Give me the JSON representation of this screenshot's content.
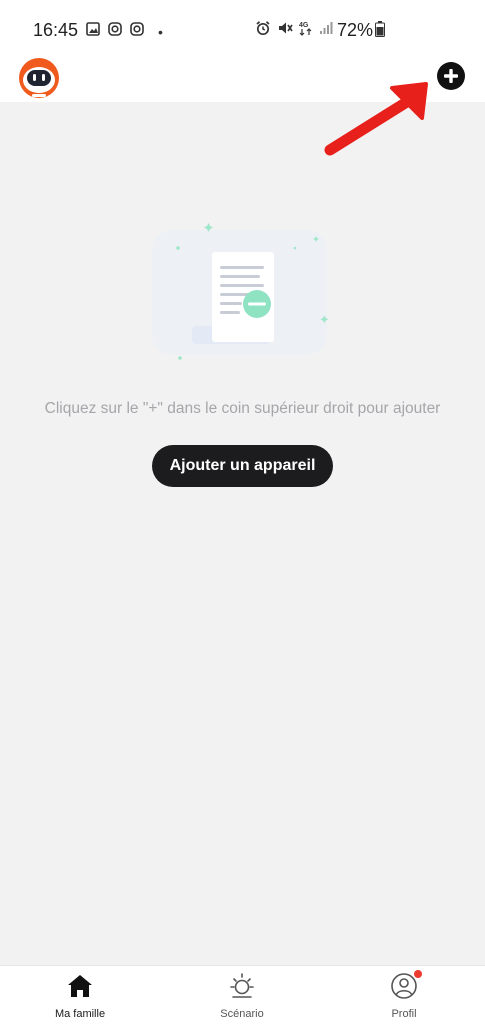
{
  "status_bar": {
    "time": "16:45",
    "battery": "72%",
    "dot": "•",
    "icons_left": [
      "gallery-icon",
      "instagram-icon",
      "instagram-icon"
    ],
    "icons_right": [
      "alarm-icon",
      "mute-icon",
      "4g-icon",
      "signal-icon",
      "battery-icon"
    ]
  },
  "header": {
    "avatar_icon": "robot-avatar-icon",
    "add_icon": "plus-icon",
    "annotation": "red-arrow-icon"
  },
  "empty_state": {
    "illustration": "empty-document-icon",
    "message": "Cliquez sur le \"+\" dans le coin supérieur droit pour ajouter",
    "button_label": "Ajouter un appareil"
  },
  "nav": {
    "items": [
      {
        "label": "Ma famille",
        "icon": "home-icon",
        "active": true
      },
      {
        "label": "Scénario",
        "icon": "sun-icon",
        "active": false
      },
      {
        "label": "Profil",
        "icon": "user-icon",
        "active": false,
        "badge": true
      }
    ]
  },
  "colors": {
    "background": "#f2f2f3",
    "button": "#1c1c1e",
    "arrow": "#e8201b",
    "accent_green": "#7fe0bc",
    "badge": "#ee3b30"
  }
}
